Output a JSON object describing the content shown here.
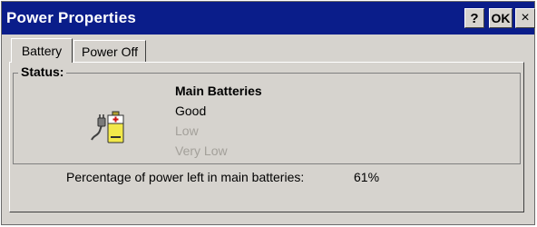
{
  "window": {
    "title": "Power Properties",
    "buttons": {
      "help": "?",
      "ok": "OK",
      "close": "×"
    }
  },
  "tabs": [
    {
      "label": "Battery",
      "active": true
    },
    {
      "label": "Power Off",
      "active": false
    }
  ],
  "status": {
    "group_label": "Status:",
    "heading": "Main Batteries",
    "levels": [
      {
        "label": "Good",
        "active": true
      },
      {
        "label": "Low",
        "active": false
      },
      {
        "label": "Very Low",
        "active": false
      }
    ],
    "icon": "battery-icon"
  },
  "percentage": {
    "label": "Percentage of power left in main batteries:",
    "value": "61%"
  },
  "colors": {
    "titlebar": "#0a1d8a",
    "dialog": "#d6d3ce",
    "disabled_text": "#a3a09a"
  }
}
